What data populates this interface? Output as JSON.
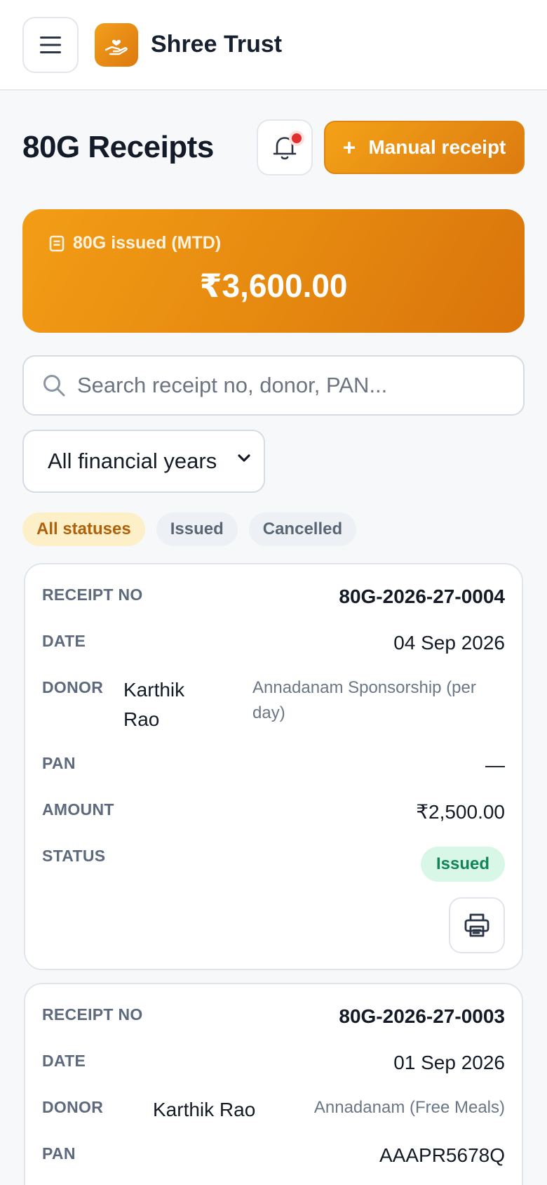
{
  "app": {
    "name": "Shree Trust"
  },
  "icons": {
    "menu": "hamburger-menu-icon",
    "logo": "hand-heart-icon",
    "bell": "bell-icon",
    "summary": "receipt-icon",
    "search": "search-icon",
    "print": "printer-icon"
  },
  "colors": {
    "accent": "#EE9113",
    "accent_dark": "#DC7B10",
    "issued_bg": "#D8F7E6",
    "issued_text": "#12845A",
    "notification_dot": "#E0302E"
  },
  "header": {
    "title": "80G Receipts",
    "manual_button": {
      "icon": "+",
      "label": "Manual receipt"
    }
  },
  "summary": {
    "label": "80G issued (MTD)",
    "value": "₹3,600.00"
  },
  "search": {
    "placeholder": "Search receipt no, donor, PAN...",
    "value": ""
  },
  "filters": {
    "financial_year": {
      "selected": "All financial years"
    },
    "statuses": [
      {
        "label": "All statuses",
        "active": true
      },
      {
        "label": "Issued",
        "active": false
      },
      {
        "label": "Cancelled",
        "active": false
      }
    ]
  },
  "labels": {
    "receipt_no": "RECEIPT NO",
    "date": "DATE",
    "donor": "DONOR",
    "pan": "PAN",
    "amount": "AMOUNT",
    "status": "STATUS"
  },
  "receipts": [
    {
      "receipt_no": "80G-2026-27-0004",
      "date": "04 Sep 2026",
      "donor_name": "Karthik Rao",
      "purpose": "Annadanam Sponsorship (per day)",
      "pan": "—",
      "amount": "₹2,500.00",
      "status": "Issued"
    },
    {
      "receipt_no": "80G-2026-27-0003",
      "date": "01 Sep 2026",
      "donor_name": "Karthik Rao",
      "purpose": "Annadanam (Free Meals)",
      "pan": "AAAPR5678Q"
    }
  ]
}
